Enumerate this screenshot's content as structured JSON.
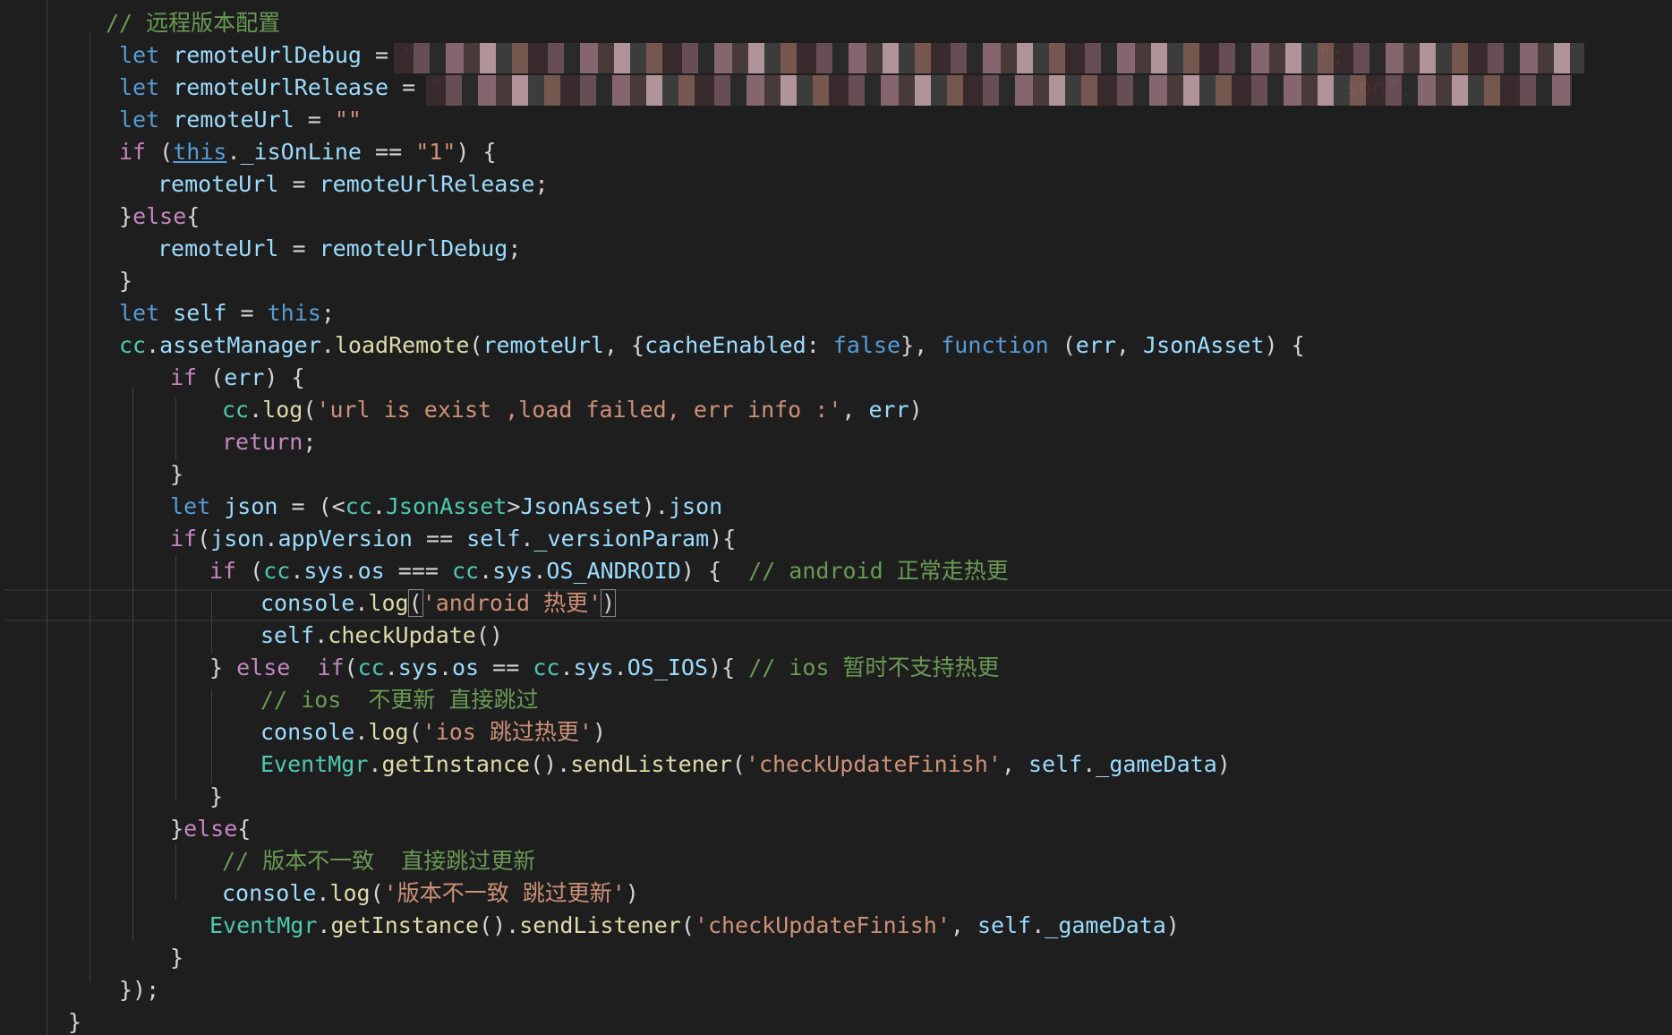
{
  "lines": [
    [
      {
        "c": "cm",
        "t": "// 远程版本配置"
      }
    ],
    [
      {
        "c": "kw",
        "t": "let "
      },
      {
        "c": "var",
        "t": "remoteUrlDebug"
      },
      {
        "c": "pl",
        "t": " = "
      },
      {
        "c": "str",
        "t": "\""
      },
      {
        "c": "pl",
        "t": "                                                                   "
      },
      {
        "c": "str",
        "t": "\""
      },
      {
        "c": "pl",
        "t": ";"
      }
    ],
    [
      {
        "c": "kw",
        "t": "let "
      },
      {
        "c": "var",
        "t": "remoteUrlRelease"
      },
      {
        "c": "pl",
        "t": " = "
      },
      {
        "c": "str",
        "t": "\""
      },
      {
        "c": "pl",
        "t": "                                                                   "
      },
      {
        "c": "str",
        "t": "son\""
      },
      {
        "c": "pl",
        "t": ";"
      }
    ],
    [
      {
        "c": "kw",
        "t": "let "
      },
      {
        "c": "var",
        "t": "remoteUrl"
      },
      {
        "c": "pl",
        "t": " = "
      },
      {
        "c": "str",
        "t": "\"\""
      }
    ],
    [
      {
        "c": "ctl",
        "t": "if"
      },
      {
        "c": "pl",
        "t": " ("
      },
      {
        "c": "kw ul",
        "t": "this"
      },
      {
        "c": "pl",
        "t": "."
      },
      {
        "c": "var",
        "t": "_isOnLine"
      },
      {
        "c": "pl",
        "t": " == "
      },
      {
        "c": "str",
        "t": "\"1\""
      },
      {
        "c": "pl",
        "t": ") {"
      }
    ],
    [
      {
        "c": "var",
        "t": "remoteUrl"
      },
      {
        "c": "pl",
        "t": " = "
      },
      {
        "c": "var",
        "t": "remoteUrlRelease"
      },
      {
        "c": "pl",
        "t": ";"
      }
    ],
    [
      {
        "c": "pl",
        "t": "}"
      },
      {
        "c": "ctl",
        "t": "else"
      },
      {
        "c": "pl",
        "t": "{"
      }
    ],
    [
      {
        "c": "var",
        "t": "remoteUrl"
      },
      {
        "c": "pl",
        "t": " = "
      },
      {
        "c": "var",
        "t": "remoteUrlDebug"
      },
      {
        "c": "pl",
        "t": ";"
      }
    ],
    [
      {
        "c": "pl",
        "t": "}"
      }
    ],
    [
      {
        "c": "kw",
        "t": "let "
      },
      {
        "c": "var",
        "t": "self"
      },
      {
        "c": "pl",
        "t": " = "
      },
      {
        "c": "kw",
        "t": "this"
      },
      {
        "c": "pl",
        "t": ";"
      }
    ],
    [
      {
        "c": "ty",
        "t": "cc"
      },
      {
        "c": "pl",
        "t": "."
      },
      {
        "c": "var",
        "t": "assetManager"
      },
      {
        "c": "pl",
        "t": "."
      },
      {
        "c": "fn",
        "t": "loadRemote"
      },
      {
        "c": "pl",
        "t": "("
      },
      {
        "c": "var",
        "t": "remoteUrl"
      },
      {
        "c": "pl",
        "t": ", {"
      },
      {
        "c": "var",
        "t": "cacheEnabled"
      },
      {
        "c": "pl",
        "t": ": "
      },
      {
        "c": "kw",
        "t": "false"
      },
      {
        "c": "pl",
        "t": "}, "
      },
      {
        "c": "kw",
        "t": "function"
      },
      {
        "c": "pl",
        "t": " ("
      },
      {
        "c": "var",
        "t": "err"
      },
      {
        "c": "pl",
        "t": ", "
      },
      {
        "c": "var",
        "t": "JsonAsset"
      },
      {
        "c": "pl",
        "t": ") {"
      }
    ],
    [
      {
        "c": "ctl",
        "t": "if"
      },
      {
        "c": "pl",
        "t": " ("
      },
      {
        "c": "var",
        "t": "err"
      },
      {
        "c": "pl",
        "t": ") {"
      }
    ],
    [
      {
        "c": "ty",
        "t": "cc"
      },
      {
        "c": "pl",
        "t": "."
      },
      {
        "c": "fn",
        "t": "log"
      },
      {
        "c": "pl",
        "t": "("
      },
      {
        "c": "str",
        "t": "'url is exist ,load failed, err info :'"
      },
      {
        "c": "pl",
        "t": ", "
      },
      {
        "c": "var",
        "t": "err"
      },
      {
        "c": "pl",
        "t": ")"
      }
    ],
    [
      {
        "c": "ctl",
        "t": "return"
      },
      {
        "c": "pl",
        "t": ";"
      }
    ],
    [
      {
        "c": "pl",
        "t": "}"
      }
    ],
    [
      {
        "c": "kw",
        "t": "let "
      },
      {
        "c": "var",
        "t": "json"
      },
      {
        "c": "pl",
        "t": " = (<"
      },
      {
        "c": "ty",
        "t": "cc"
      },
      {
        "c": "pl",
        "t": "."
      },
      {
        "c": "ty",
        "t": "JsonAsset"
      },
      {
        "c": "pl",
        "t": ">"
      },
      {
        "c": "var",
        "t": "JsonAsset"
      },
      {
        "c": "pl",
        "t": ")."
      },
      {
        "c": "var",
        "t": "json"
      }
    ],
    [
      {
        "c": "ctl",
        "t": "if"
      },
      {
        "c": "pl",
        "t": "("
      },
      {
        "c": "var",
        "t": "json"
      },
      {
        "c": "pl",
        "t": "."
      },
      {
        "c": "var",
        "t": "appVersion"
      },
      {
        "c": "pl",
        "t": " == "
      },
      {
        "c": "var",
        "t": "self"
      },
      {
        "c": "pl",
        "t": "."
      },
      {
        "c": "var",
        "t": "_versionParam"
      },
      {
        "c": "pl",
        "t": "){"
      }
    ],
    [
      {
        "c": "ctl",
        "t": "if"
      },
      {
        "c": "pl",
        "t": " ("
      },
      {
        "c": "ty",
        "t": "cc"
      },
      {
        "c": "pl",
        "t": "."
      },
      {
        "c": "var",
        "t": "sys"
      },
      {
        "c": "pl",
        "t": "."
      },
      {
        "c": "var",
        "t": "os"
      },
      {
        "c": "pl",
        "t": " === "
      },
      {
        "c": "ty",
        "t": "cc"
      },
      {
        "c": "pl",
        "t": "."
      },
      {
        "c": "var",
        "t": "sys"
      },
      {
        "c": "pl",
        "t": "."
      },
      {
        "c": "var",
        "t": "OS_ANDROID"
      },
      {
        "c": "pl",
        "t": ") {  "
      },
      {
        "c": "cm",
        "t": "// android 正常走热更"
      }
    ],
    [
      {
        "c": "var",
        "t": "console"
      },
      {
        "c": "pl",
        "t": "."
      },
      {
        "c": "fn",
        "t": "log"
      },
      {
        "c": "pl bracket-match",
        "t": "("
      },
      {
        "c": "str",
        "t": "'android 热更'"
      },
      {
        "c": "pl bracket-match",
        "t": ")"
      }
    ],
    [
      {
        "c": "var",
        "t": "self"
      },
      {
        "c": "pl",
        "t": "."
      },
      {
        "c": "fn",
        "t": "checkUpdate"
      },
      {
        "c": "pl",
        "t": "()"
      }
    ],
    [
      {
        "c": "pl",
        "t": "} "
      },
      {
        "c": "ctl",
        "t": "else"
      },
      {
        "c": "pl",
        "t": "  "
      },
      {
        "c": "ctl",
        "t": "if"
      },
      {
        "c": "pl",
        "t": "("
      },
      {
        "c": "ty",
        "t": "cc"
      },
      {
        "c": "pl",
        "t": "."
      },
      {
        "c": "var",
        "t": "sys"
      },
      {
        "c": "pl",
        "t": "."
      },
      {
        "c": "var",
        "t": "os"
      },
      {
        "c": "pl",
        "t": " == "
      },
      {
        "c": "ty",
        "t": "cc"
      },
      {
        "c": "pl",
        "t": "."
      },
      {
        "c": "var",
        "t": "sys"
      },
      {
        "c": "pl",
        "t": "."
      },
      {
        "c": "var",
        "t": "OS_IOS"
      },
      {
        "c": "pl",
        "t": "){ "
      },
      {
        "c": "cm",
        "t": "// ios 暂时不支持热更"
      }
    ],
    [
      {
        "c": "cm",
        "t": "// ios  不更新 直接跳过"
      }
    ],
    [
      {
        "c": "var",
        "t": "console"
      },
      {
        "c": "pl",
        "t": "."
      },
      {
        "c": "fn",
        "t": "log"
      },
      {
        "c": "pl",
        "t": "("
      },
      {
        "c": "str",
        "t": "'ios 跳过热更'"
      },
      {
        "c": "pl",
        "t": ")"
      }
    ],
    [
      {
        "c": "ty",
        "t": "EventMgr"
      },
      {
        "c": "pl",
        "t": "."
      },
      {
        "c": "fn",
        "t": "getInstance"
      },
      {
        "c": "pl",
        "t": "()."
      },
      {
        "c": "fn",
        "t": "sendListener"
      },
      {
        "c": "pl",
        "t": "("
      },
      {
        "c": "str",
        "t": "'checkUpdateFinish'"
      },
      {
        "c": "pl",
        "t": ", "
      },
      {
        "c": "var",
        "t": "self"
      },
      {
        "c": "pl",
        "t": "."
      },
      {
        "c": "var",
        "t": "_gameData"
      },
      {
        "c": "pl",
        "t": ")"
      }
    ],
    [
      {
        "c": "pl",
        "t": "}"
      }
    ],
    [
      {
        "c": "pl",
        "t": "}"
      },
      {
        "c": "ctl",
        "t": "else"
      },
      {
        "c": "pl",
        "t": "{"
      }
    ],
    [
      {
        "c": "cm",
        "t": "// 版本不一致  直接跳过更新"
      }
    ],
    [
      {
        "c": "var",
        "t": "console"
      },
      {
        "c": "pl",
        "t": "."
      },
      {
        "c": "fn",
        "t": "log"
      },
      {
        "c": "pl",
        "t": "("
      },
      {
        "c": "str",
        "t": "'版本不一致 跳过更新'"
      },
      {
        "c": "pl",
        "t": ")"
      }
    ],
    [
      {
        "c": "ty",
        "t": "EventMgr"
      },
      {
        "c": "pl",
        "t": "."
      },
      {
        "c": "fn",
        "t": "getInstance"
      },
      {
        "c": "pl",
        "t": "()."
      },
      {
        "c": "fn",
        "t": "sendListener"
      },
      {
        "c": "pl",
        "t": "("
      },
      {
        "c": "str",
        "t": "'checkUpdateFinish'"
      },
      {
        "c": "pl",
        "t": ", "
      },
      {
        "c": "var",
        "t": "self"
      },
      {
        "c": "pl",
        "t": "."
      },
      {
        "c": "var",
        "t": "_gameData"
      },
      {
        "c": "pl",
        "t": ")"
      }
    ],
    [
      {
        "c": "pl",
        "t": "}"
      }
    ],
    [
      {
        "c": "pl",
        "t": "});"
      }
    ],
    [
      {
        "c": "pl",
        "t": "}"
      }
    ]
  ]
}
